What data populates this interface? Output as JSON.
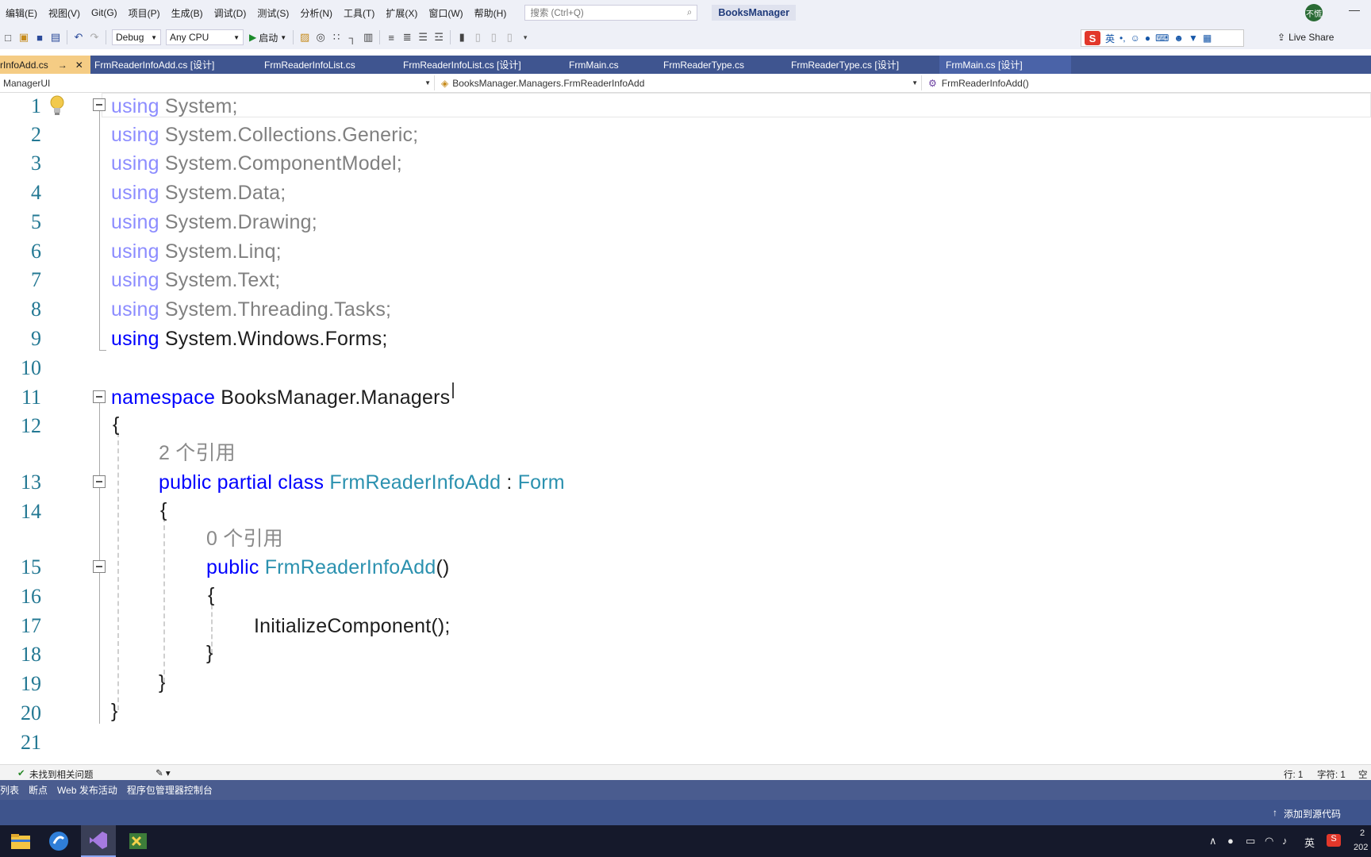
{
  "menu": {
    "items": [
      "编辑(E)",
      "视图(V)",
      "Git(G)",
      "项目(P)",
      "生成(B)",
      "调试(D)",
      "测试(S)",
      "分析(N)",
      "工具(T)",
      "扩展(X)",
      "窗口(W)",
      "帮助(H)"
    ],
    "search_placeholder": "搜索 (Ctrl+Q)",
    "project_name": "BooksManager",
    "avatar_text": "不慌"
  },
  "toolbar": {
    "config": "Debug",
    "platform": "Any CPU",
    "start_label": "启动",
    "live_share": "Live Share",
    "ime_lang": "英"
  },
  "tabs": [
    {
      "label": "rInfoAdd.cs",
      "active": true
    },
    {
      "label": "FrmReaderInfoAdd.cs [设计]"
    },
    {
      "label": "FrmReaderInfoList.cs"
    },
    {
      "label": "FrmReaderInfoList.cs [设计]"
    },
    {
      "label": "FrmMain.cs"
    },
    {
      "label": "FrmReaderType.cs"
    },
    {
      "label": "FrmReaderType.cs [设计]"
    },
    {
      "label": "FrmMain.cs [设计]"
    }
  ],
  "navbar": {
    "project": "ManagerUI",
    "class": "BooksManager.Managers.FrmReaderInfoAdd",
    "member": "FrmReaderInfoAdd()"
  },
  "code": {
    "line_numbers": [
      "1",
      "2",
      "3",
      "4",
      "5",
      "6",
      "7",
      "8",
      "9",
      "10",
      "11",
      "12",
      "13",
      "14",
      "15",
      "16",
      "17",
      "18",
      "19",
      "20",
      "21"
    ],
    "using_kw": "using",
    "usings": [
      "System;",
      "System.Collections.Generic;",
      "System.ComponentModel;",
      "System.Data;",
      "System.Drawing;",
      "System.Linq;",
      "System.Text;",
      "System.Threading.Tasks;",
      "System.Windows.Forms;"
    ],
    "namespace_kw": "namespace",
    "namespace_name": "BooksManager.Managers",
    "open_brace": "{",
    "close_brace": "}",
    "ref_class": "2 个引用",
    "class_kw": "public partial class",
    "class_name": "FrmReaderInfoAdd",
    "colon": ":",
    "base_class": "Form",
    "ref_ctor": "0 个引用",
    "public_kw": "public",
    "ctor_name": "FrmReaderInfoAdd",
    "parens": "()",
    "ctor_body": "InitializeComponent();"
  },
  "status": {
    "issues": "未找到相关问题",
    "line": "行: 1",
    "char": "字符: 1",
    "extra": "空格"
  },
  "panels": [
    "列表",
    "断点",
    "Web 发布活动",
    "程序包管理器控制台"
  ],
  "statusbar": {
    "source_control": "添加到源代码"
  },
  "taskbar": {
    "ime": "英",
    "clock_time": "2",
    "clock_date": "202"
  }
}
